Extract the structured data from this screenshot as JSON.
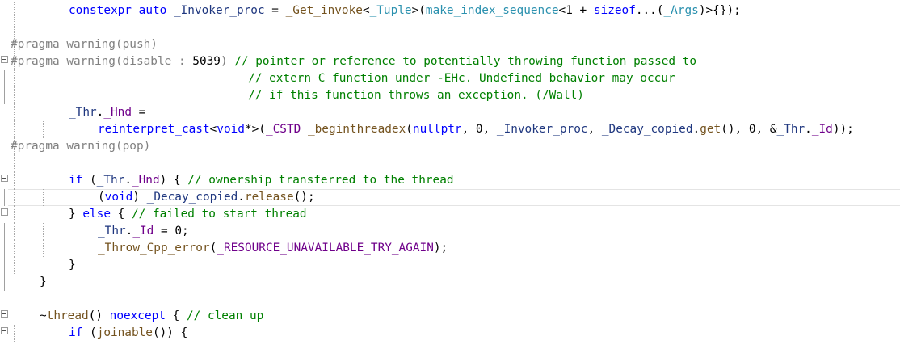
{
  "editor": {
    "language": "cpp",
    "current_line": 11,
    "lines": [
      {
        "indent": 2,
        "guides": [
          1
        ],
        "fold": false,
        "rail": false,
        "tokens": [
          {
            "c": "constexpr",
            "s": "k"
          },
          {
            "c": " ",
            "s": "n"
          },
          {
            "c": "auto",
            "s": "k"
          },
          {
            "c": " ",
            "s": "n"
          },
          {
            "c": "_Invoker_proc",
            "s": "v"
          },
          {
            "c": " = ",
            "s": "n"
          },
          {
            "c": "_Get_invoke",
            "s": "f"
          },
          {
            "c": "<",
            "s": "n"
          },
          {
            "c": "_Tuple",
            "s": "t"
          },
          {
            "c": ">(",
            "s": "n"
          },
          {
            "c": "make_index_sequence",
            "s": "t"
          },
          {
            "c": "<1 + ",
            "s": "n"
          },
          {
            "c": "sizeof",
            "s": "k"
          },
          {
            "c": "...(",
            "s": "n"
          },
          {
            "c": "_Args",
            "s": "t"
          },
          {
            "c": ")>{});",
            "s": "n"
          }
        ]
      },
      {
        "indent": 0,
        "guides": [
          1
        ],
        "fold": false,
        "rail": false,
        "tokens": []
      },
      {
        "indent": 0,
        "guides": [
          1
        ],
        "fold": false,
        "rail": false,
        "tokens": [
          {
            "c": "#pragma",
            "s": "p"
          },
          {
            "c": " warning(push)",
            "s": "p"
          }
        ]
      },
      {
        "indent": 0,
        "guides": [
          1
        ],
        "fold": true,
        "rail": false,
        "tokens": [
          {
            "c": "#pragma",
            "s": "p"
          },
          {
            "c": " warning(disable : ",
            "s": "p"
          },
          {
            "c": "5039",
            "s": "n"
          },
          {
            "c": ") ",
            "s": "p"
          },
          {
            "c": "// pointer or reference to potentially throwing function passed to",
            "s": "c"
          }
        ]
      },
      {
        "indent": 0,
        "pad": 36,
        "guides": [
          1
        ],
        "fold": false,
        "rail": true,
        "tokens": [
          {
            "c": "// extern C function under -EHc. Undefined behavior may occur",
            "s": "c"
          }
        ]
      },
      {
        "indent": 0,
        "pad": 36,
        "guides": [
          1
        ],
        "fold": false,
        "rail": true,
        "tokens": [
          {
            "c": "// if this function throws an exception. (/Wall)",
            "s": "c"
          }
        ]
      },
      {
        "indent": 2,
        "guides": [
          1
        ],
        "fold": false,
        "rail": false,
        "tokens": [
          {
            "c": "_Thr",
            "s": "v"
          },
          {
            "c": ".",
            "s": "n"
          },
          {
            "c": "_Hnd",
            "s": "m"
          },
          {
            "c": " =",
            "s": "n"
          }
        ]
      },
      {
        "indent": 3,
        "guides": [
          1,
          2
        ],
        "fold": false,
        "rail": false,
        "tokens": [
          {
            "c": "reinterpret_cast",
            "s": "k"
          },
          {
            "c": "<",
            "s": "n"
          },
          {
            "c": "void",
            "s": "k"
          },
          {
            "c": "*>(",
            "s": "n"
          },
          {
            "c": "_CSTD",
            "s": "m"
          },
          {
            "c": " ",
            "s": "n"
          },
          {
            "c": "_beginthreadex",
            "s": "f"
          },
          {
            "c": "(",
            "s": "n"
          },
          {
            "c": "nullptr",
            "s": "k"
          },
          {
            "c": ", 0, ",
            "s": "n"
          },
          {
            "c": "_Invoker_proc",
            "s": "v"
          },
          {
            "c": ", ",
            "s": "n"
          },
          {
            "c": "_Decay_copied",
            "s": "v"
          },
          {
            "c": ".",
            "s": "n"
          },
          {
            "c": "get",
            "s": "f"
          },
          {
            "c": "(), 0, &",
            "s": "n"
          },
          {
            "c": "_Thr",
            "s": "v"
          },
          {
            "c": ".",
            "s": "n"
          },
          {
            "c": "_Id",
            "s": "m"
          },
          {
            "c": "));",
            "s": "n"
          }
        ]
      },
      {
        "indent": 0,
        "guides": [
          1
        ],
        "fold": false,
        "rail": false,
        "tokens": [
          {
            "c": "#pragma",
            "s": "p"
          },
          {
            "c": " warning(pop)",
            "s": "p"
          }
        ]
      },
      {
        "indent": 0,
        "guides": [
          1
        ],
        "fold": false,
        "rail": false,
        "tokens": []
      },
      {
        "indent": 2,
        "guides": [
          1
        ],
        "fold": true,
        "rail": false,
        "tokens": [
          {
            "c": "if",
            "s": "k"
          },
          {
            "c": " (",
            "s": "n"
          },
          {
            "c": "_Thr",
            "s": "v"
          },
          {
            "c": ".",
            "s": "n"
          },
          {
            "c": "_Hnd",
            "s": "m"
          },
          {
            "c": ") { ",
            "s": "n"
          },
          {
            "c": "// ownership transferred to the thread",
            "s": "c"
          }
        ]
      },
      {
        "indent": 3,
        "guides": [
          1,
          2
        ],
        "fold": false,
        "rail": true,
        "tokens": [
          {
            "c": "(",
            "s": "n"
          },
          {
            "c": "void",
            "s": "k"
          },
          {
            "c": ") ",
            "s": "n"
          },
          {
            "c": "_Decay_copied",
            "s": "v"
          },
          {
            "c": ".",
            "s": "n"
          },
          {
            "c": "release",
            "s": "f"
          },
          {
            "c": "();",
            "s": "n"
          }
        ]
      },
      {
        "indent": 2,
        "guides": [
          1
        ],
        "fold": true,
        "rail": false,
        "tokens": [
          {
            "c": "} ",
            "s": "n"
          },
          {
            "c": "else",
            "s": "k"
          },
          {
            "c": " { ",
            "s": "n"
          },
          {
            "c": "// failed to start thread",
            "s": "c"
          }
        ]
      },
      {
        "indent": 3,
        "guides": [
          1,
          2
        ],
        "fold": false,
        "rail": true,
        "tokens": [
          {
            "c": "_Thr",
            "s": "v"
          },
          {
            "c": ".",
            "s": "n"
          },
          {
            "c": "_Id",
            "s": "m"
          },
          {
            "c": " = 0;",
            "s": "n"
          }
        ]
      },
      {
        "indent": 3,
        "guides": [
          1,
          2
        ],
        "fold": false,
        "rail": true,
        "tokens": [
          {
            "c": "_Throw_Cpp_error",
            "s": "f"
          },
          {
            "c": "(",
            "s": "n"
          },
          {
            "c": "_RESOURCE_UNAVAILABLE_TRY_AGAIN",
            "s": "m"
          },
          {
            "c": ");",
            "s": "n"
          }
        ]
      },
      {
        "indent": 2,
        "guides": [
          1
        ],
        "fold": false,
        "rail": true,
        "tokens": [
          {
            "c": "}",
            "s": "n"
          }
        ]
      },
      {
        "indent": 1,
        "guides": [],
        "fold": false,
        "rail": true,
        "tokens": [
          {
            "c": "}",
            "s": "n"
          }
        ]
      },
      {
        "indent": 0,
        "guides": [],
        "fold": false,
        "rail": false,
        "tokens": []
      },
      {
        "indent": 1,
        "guides": [],
        "fold": true,
        "rail": false,
        "tokens": [
          {
            "c": "~",
            "s": "n"
          },
          {
            "c": "thread",
            "s": "f"
          },
          {
            "c": "() ",
            "s": "n"
          },
          {
            "c": "noexcept",
            "s": "k"
          },
          {
            "c": " { ",
            "s": "n"
          },
          {
            "c": "// clean up",
            "s": "c"
          }
        ]
      },
      {
        "indent": 2,
        "guides": [
          1
        ],
        "fold": true,
        "rail": false,
        "tokens": [
          {
            "c": "if",
            "s": "k"
          },
          {
            "c": " (",
            "s": "n"
          },
          {
            "c": "joinable",
            "s": "f"
          },
          {
            "c": "()) {",
            "s": "n"
          }
        ]
      }
    ]
  }
}
